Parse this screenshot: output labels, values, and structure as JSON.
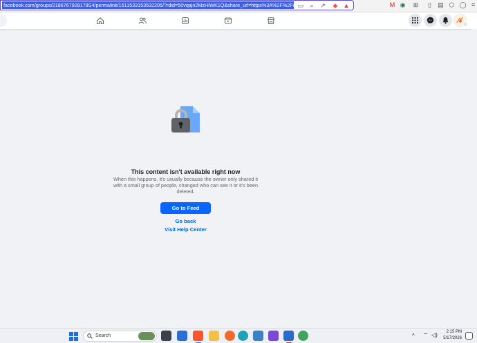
{
  "browser": {
    "url": "facebook.com/groups/2186767928178S4/permalink/1511533153532205/?rdid=50vqajn2MzHIWK1Q&share_url=https%3A%2F%2Fw"
  },
  "content": {
    "title": "This content isn't available right now",
    "description": "When this happens, it's usually because the owner only shared it with a small group of people, changed who can see it or it's been deleted.",
    "go_to_feed_label": "Go to Feed",
    "go_back_label": "Go back",
    "help_center_label": "Visit Help Center"
  },
  "taskbar": {
    "search_label": "Search",
    "time": "2:15 PM",
    "date": "5/17/2026"
  },
  "colors": {
    "accent": "#0866ff",
    "link": "#0064d1",
    "page_bg": "#f0f2f5"
  }
}
